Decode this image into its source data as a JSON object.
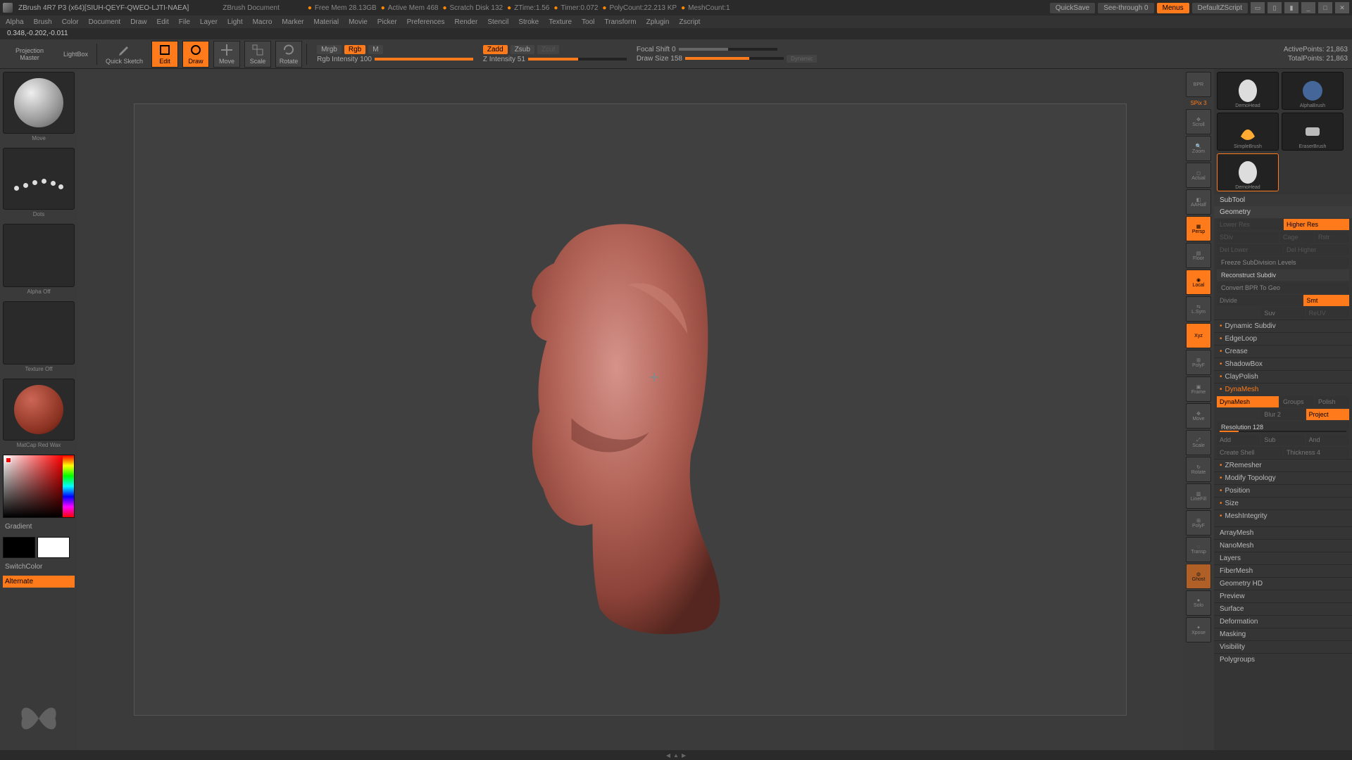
{
  "titlebar": {
    "app": "ZBrush 4R7 P3 (x64)[SIUH-QEYF-QWEO-LJTI-NAEA]",
    "doc": "ZBrush Document",
    "stats": {
      "free_mem": "Free Mem 28.13GB",
      "active_mem": "Active Mem 468",
      "scratch": "Scratch Disk 132",
      "ztime": "ZTime:1.56",
      "timer": "Timer:0.072",
      "polycount": "PolyCount:22.213 KP",
      "meshcount": "MeshCount:1"
    },
    "quicksave": "QuickSave",
    "seethrough": "See-through  0",
    "menus": "Menus",
    "script": "DefaultZScript"
  },
  "menu": [
    "Alpha",
    "Brush",
    "Color",
    "Document",
    "Draw",
    "Edit",
    "File",
    "Layer",
    "Light",
    "Macro",
    "Marker",
    "Material",
    "Movie",
    "Picker",
    "Preferences",
    "Render",
    "Stencil",
    "Stroke",
    "Texture",
    "Tool",
    "Transform",
    "Zplugin",
    "Zscript"
  ],
  "status": "0.348,-0.202,-0.011",
  "shelf": {
    "projection": "Projection Master",
    "lightbox": "LightBox",
    "quicksketch": "Quick Sketch",
    "edit": "Edit",
    "draw": "Draw",
    "move": "Move",
    "scale": "Scale",
    "rotate": "Rotate",
    "mrgb": "Mrgb",
    "rgb": "Rgb",
    "m": "M",
    "rgb_intensity": "Rgb Intensity 100",
    "zadd": "Zadd",
    "zsub": "Zsub",
    "zcut": "Zcut",
    "z_intensity": "Z Intensity 51",
    "focal": "Focal Shift 0",
    "draw_size": "Draw Size 158",
    "dynamic": "Dynamic",
    "active_pts": "ActivePoints: 21,863",
    "total_pts": "TotalPoints: 21,863"
  },
  "left": {
    "brush": "Move",
    "stroke": "Dots",
    "alpha": "Alpha Off",
    "texture": "Texture Off",
    "material": "MatCap Red Wax",
    "gradient": "Gradient",
    "switch": "SwitchColor",
    "alternate": "Alternate"
  },
  "dock": {
    "spix": "SPix 3",
    "labels": [
      "BPR",
      "Scroll",
      "Zoom",
      "Actual",
      "AAHalf",
      "Persp",
      "Floor",
      "Local",
      "L.Sym",
      "Xyz",
      "PolyF",
      "Frame",
      "Move",
      "Scale",
      "Rotate",
      "LineFill",
      "PolyF",
      "Transp",
      "Ghost",
      "Solo",
      "Xpose"
    ]
  },
  "tools": {
    "tiles": [
      "DemoHead",
      "AlphaBrush",
      "SimpleBrush",
      "EraserBrush",
      "DemoHead"
    ],
    "subtool": "SubTool",
    "geometry": "Geometry",
    "lower_res": "Lower Res",
    "higher_res": "Higher Res",
    "sdiv": "SDiv",
    "cage": "Cage",
    "rstr": "Rstr",
    "del_lower": "Del Lower",
    "del_higher": "Del Higher",
    "freeze": "Freeze SubDivision Levels",
    "reconstruct": "Reconstruct Subdiv",
    "convert": "Convert BPR To Geo",
    "divide": "Divide",
    "smt": "Smt",
    "suv": "Suv",
    "reuv": "ReUV",
    "dynsubdiv": "Dynamic Subdiv",
    "edgeloop": "EdgeLoop",
    "crease": "Crease",
    "shadowbox": "ShadowBox",
    "claypolish": "ClayPolish",
    "dynamesh_h": "DynaMesh",
    "dynamesh_btn": "DynaMesh",
    "groups": "Groups",
    "polish": "Polish",
    "blur": "Blur 2",
    "project": "Project",
    "resolution": "Resolution 128",
    "add": "Add",
    "sub": "Sub",
    "and": "And",
    "createshell": "Create Shell",
    "thickness": "Thickness 4",
    "zremesher": "ZRemesher",
    "modtopo": "Modify Topology",
    "position": "Position",
    "size": "Size",
    "meshint": "MeshIntegrity",
    "sections": [
      "ArrayMesh",
      "NanoMesh",
      "Layers",
      "FiberMesh",
      "Geometry HD",
      "Preview",
      "Surface",
      "Deformation",
      "Masking",
      "Visibility",
      "Polygroups"
    ]
  }
}
